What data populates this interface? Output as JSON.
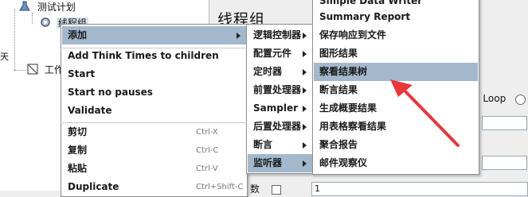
{
  "tree": {
    "test_plan": "测试计划",
    "thread_group": "线程组",
    "workbench_partial": "工作",
    "left_clip_char": "天"
  },
  "panel": {
    "title": "线程组",
    "loop_label": "d Loop",
    "bottom_left": "数",
    "bottom_value": "1"
  },
  "context_menu": {
    "items": [
      {
        "label": "添加",
        "submenu": true
      },
      {
        "label": "Add Think Times to children"
      },
      {
        "label": "Start"
      },
      {
        "label": "Start no pauses"
      },
      {
        "label": "Validate"
      },
      {
        "label": "剪切",
        "shortcut": "Ctrl-X"
      },
      {
        "label": "复制",
        "shortcut": "Ctrl-C"
      },
      {
        "label": "粘贴",
        "shortcut": "Ctrl-V"
      },
      {
        "label": "Duplicate",
        "shortcut": "Ctrl+Shift-C"
      }
    ]
  },
  "add_submenu": {
    "items": [
      {
        "label": "逻辑控制器"
      },
      {
        "label": "配置元件"
      },
      {
        "label": "定时器"
      },
      {
        "label": "前置处理器"
      },
      {
        "label": "Sampler"
      },
      {
        "label": "后置处理器"
      },
      {
        "label": "断言"
      },
      {
        "label": "监听器"
      }
    ]
  },
  "listener_submenu": {
    "items": [
      {
        "label": "Simple Data Writer"
      },
      {
        "label": "Summary Report"
      },
      {
        "label": "保存响应到文件"
      },
      {
        "label": "图形结果"
      },
      {
        "label": "察看结果树"
      },
      {
        "label": "断言结果"
      },
      {
        "label": "生成概要结果"
      },
      {
        "label": "用表格察看结果"
      },
      {
        "label": "聚合报告"
      },
      {
        "label": "邮件观察仪"
      }
    ]
  },
  "colors": {
    "menu_highlight": "#a3b8cc",
    "annotation_arrow": "#e8363a"
  }
}
